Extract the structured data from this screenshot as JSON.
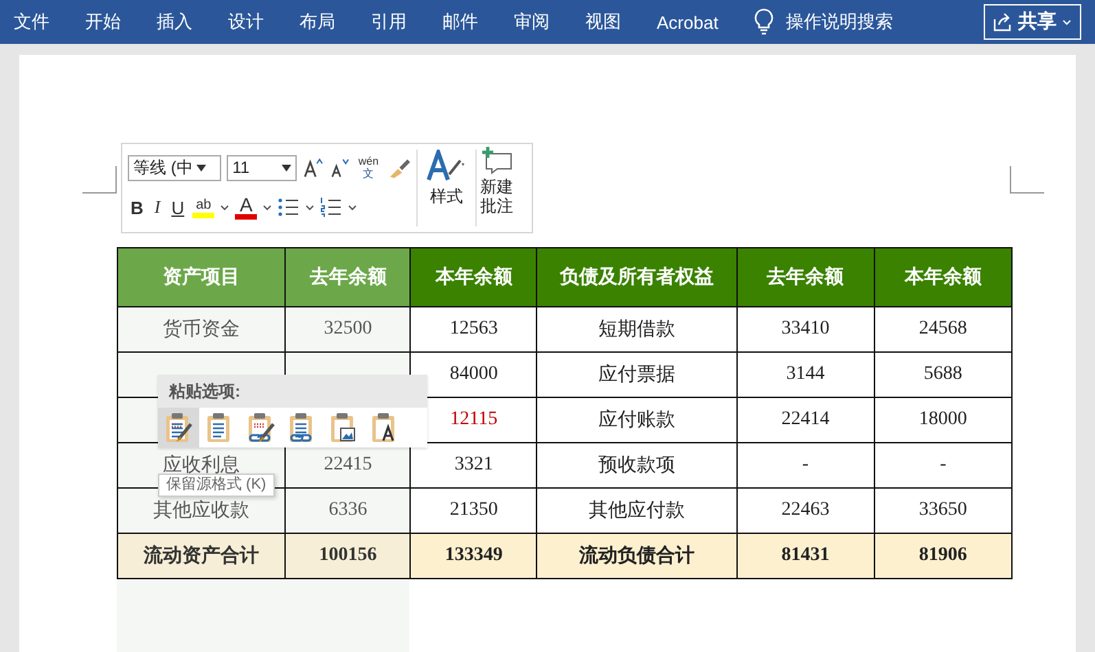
{
  "ribbon": {
    "tabs": [
      "文件",
      "开始",
      "插入",
      "设计",
      "布局",
      "引用",
      "邮件",
      "审阅",
      "视图",
      "Acrobat"
    ],
    "tell_me": "操作说明搜索",
    "share_button": "共享"
  },
  "mini_toolbar": {
    "font_name": "等线 (中",
    "font_size": "11",
    "phonetic_label": "wén",
    "phonetic_char": "文",
    "bold": "B",
    "italic": "I",
    "underline": "U",
    "highlight_label": "ab",
    "font_color_label": "A",
    "style_button": "样式",
    "new_comment_button": "新建批注"
  },
  "table": {
    "columns": [
      {
        "label": "资产项目",
        "selected": true
      },
      {
        "label": "去年余额",
        "selected": true
      },
      {
        "label": "本年余额",
        "selected": false
      },
      {
        "label": "负债及所有者权益",
        "selected": false
      },
      {
        "label": "去年余额",
        "selected": false
      },
      {
        "label": "本年余额",
        "selected": false
      }
    ],
    "rows": [
      {
        "kind": "item",
        "cells": [
          "货币资金",
          "32500",
          "12563",
          "短期借款",
          "33410",
          "24568"
        ]
      },
      {
        "kind": "item",
        "cells": [
          null,
          null,
          "84000",
          "应付票据",
          "3144",
          "5688"
        ]
      },
      {
        "kind": "item",
        "cells": [
          null,
          null,
          {
            "text": "12115",
            "color": "#c00000"
          },
          "应付账款",
          "22414",
          "18000"
        ]
      },
      {
        "kind": "item",
        "cells": [
          "应收利息",
          "22415",
          "3321",
          "预收款项",
          "-",
          "-"
        ]
      },
      {
        "kind": "item",
        "cells": [
          "其他应收款",
          "6336",
          "21350",
          "其他应付款",
          "22463",
          "33650"
        ]
      },
      {
        "kind": "total",
        "cells": [
          "流动资产合计",
          "100156",
          "133349",
          "流动负债合计",
          "81431",
          "81906"
        ]
      }
    ]
  },
  "paste_options": {
    "title": "粘贴选项:",
    "options": [
      {
        "kind": "keep-source",
        "selected": true
      },
      {
        "kind": "merge",
        "selected": false
      },
      {
        "kind": "linked-source",
        "selected": false
      },
      {
        "kind": "linked-merge",
        "selected": false
      },
      {
        "kind": "picture",
        "selected": false
      },
      {
        "kind": "text-only",
        "selected": false
      }
    ],
    "tooltip": "保留源格式 (K)"
  }
}
